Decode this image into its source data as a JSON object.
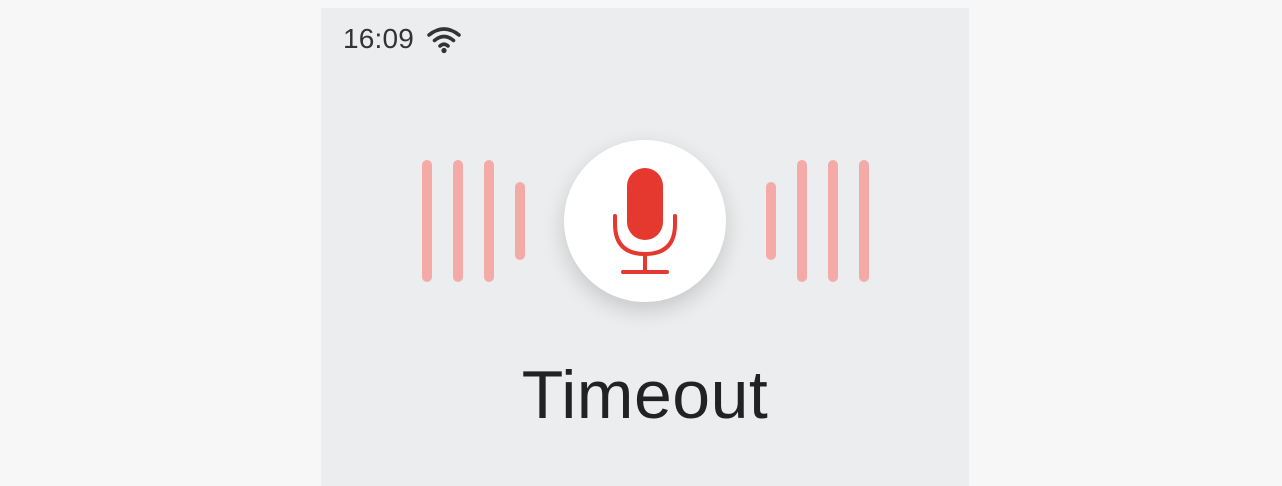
{
  "status_bar": {
    "time": "16:09",
    "wifi_icon": "wifi-icon"
  },
  "voice": {
    "mic_icon": "microphone-icon",
    "status_text": "Timeout"
  },
  "colors": {
    "outer_background": "#f7f7f7",
    "screen_background": "#ecedee",
    "accent_red": "#e5382f",
    "wave_bars": "#f4aaa6",
    "text": "#222222"
  }
}
